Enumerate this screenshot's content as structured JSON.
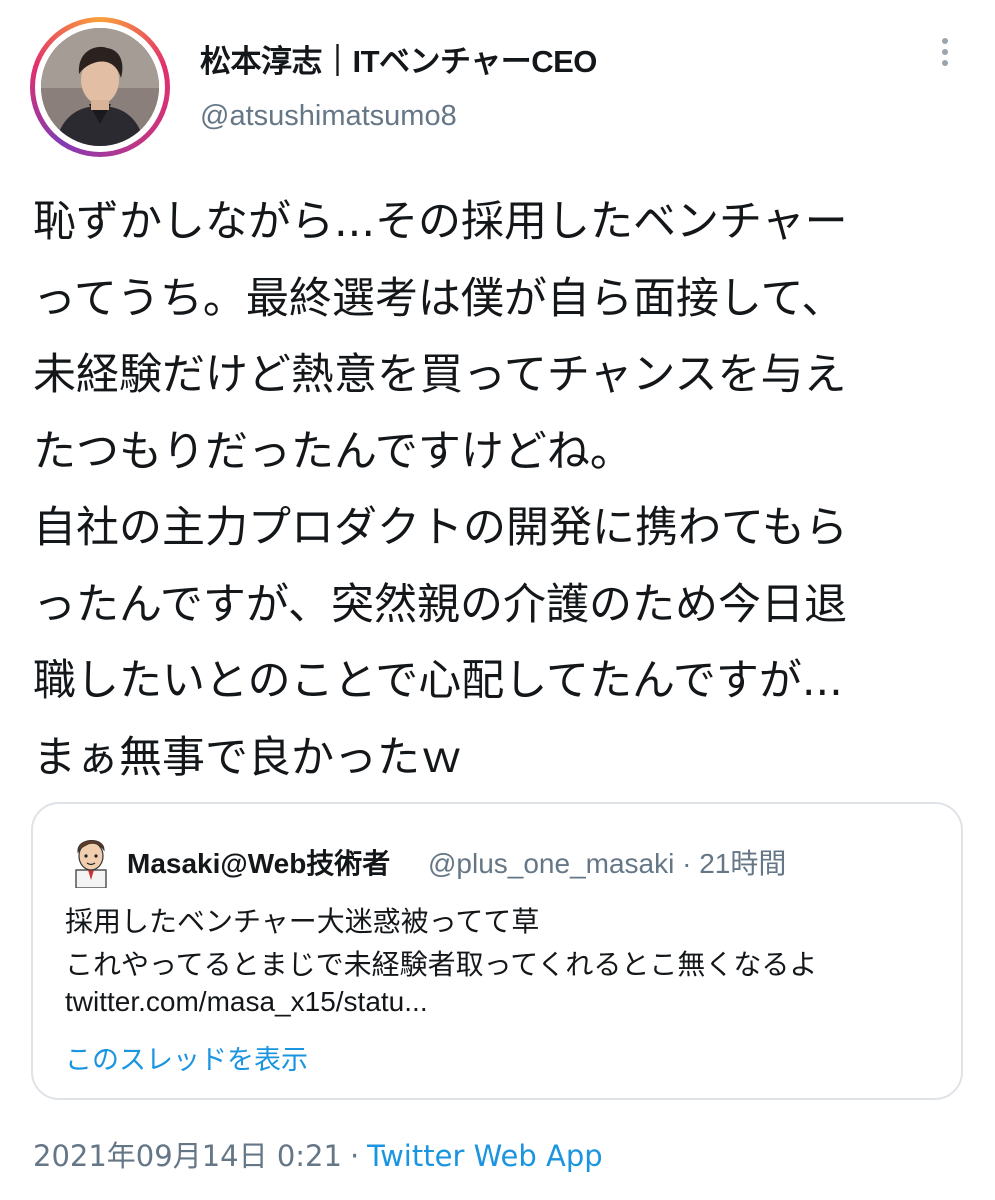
{
  "author": {
    "display_name": "松本淳志｜ITベンチャーCEO",
    "handle": "@atsushimatsumo8"
  },
  "tweet": {
    "lines": [
      "恥ずかしながら...その採用したベンチャー",
      "ってうち。最終選考は僕が自ら面接して、",
      "未経験だけど熱意を買ってチャンスを与え",
      "たつもりだったんですけどね。",
      "自社の主力プロダクトの開発に携わてもら",
      "ったんですが、突然親の介護のため今日退",
      "職したいとのことで心配してたんですが...",
      "まぁ無事で良かったｗ"
    ]
  },
  "quote": {
    "display_name": "Masaki@Web技術者",
    "meta": "@plus_one_masaki · 21時間",
    "lines": [
      "採用したベンチャー大迷惑被ってて草",
      "これやってるとまじで未経験者取ってくれるとこ無くなるよ"
    ],
    "link": "twitter.com/masa_x15/statu...",
    "show_thread": "このスレッドを表示"
  },
  "footer": {
    "date": "2021年09月14日 0:21",
    "separator": "·",
    "source": "Twitter Web App"
  },
  "icons": {
    "more": "more-vertical-icon",
    "avatar": "profile-photo",
    "quote_avatar": "cartoon-avatar"
  },
  "colors": {
    "text": "#14171a",
    "secondary": "#657786",
    "link": "#1b95e0",
    "border": "#dfe3e7"
  }
}
